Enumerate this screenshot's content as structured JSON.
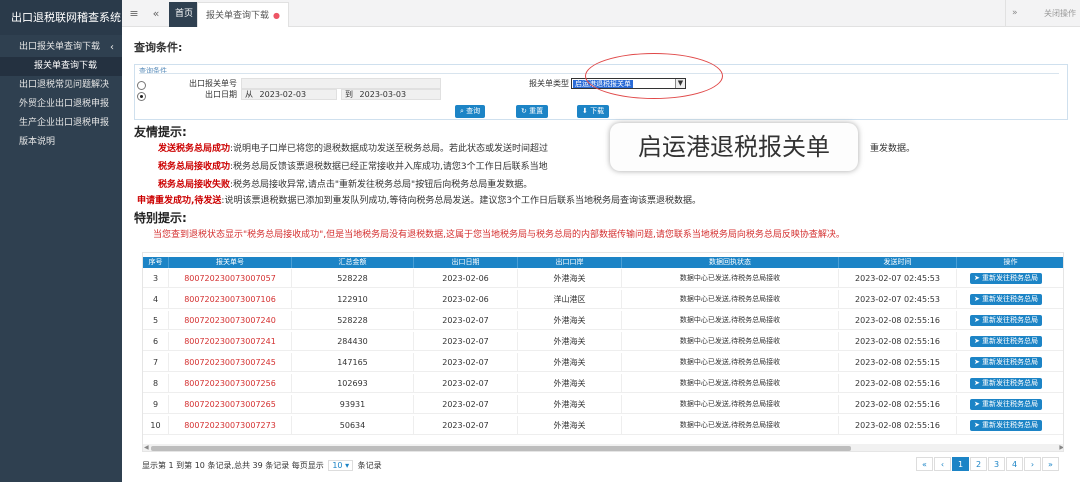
{
  "app": {
    "title": "出口退税联网稽查系统"
  },
  "sidebar": {
    "items": [
      {
        "label": "出口报关单查询下载"
      },
      {
        "label": "报关单查询下载"
      },
      {
        "label": "出口退税常见问题解决"
      },
      {
        "label": "外贸企业出口退税申报"
      },
      {
        "label": "生产企业出口退税申报"
      },
      {
        "label": "版本说明"
      }
    ]
  },
  "topbar": {
    "tab_home": "首页",
    "tab_active": "报关单查询下载",
    "close_ops": "关闭操作"
  },
  "query": {
    "heading": "查询条件:",
    "panel_title": "查询条件",
    "label_no": "出口报关单号",
    "label_date": "出口日期",
    "from_label": "从",
    "date_from": "2023-02-03",
    "to_label": "到",
    "date_to": "2023-03-03",
    "label_type": "报关单类型",
    "type_selected": "启运港退税报关单",
    "btn_query": "查询",
    "btn_reset": "重置",
    "btn_download": "下载"
  },
  "callout": {
    "text": "启运港退税报关单"
  },
  "tips": {
    "heading": "友情提示:",
    "line1_key": "发送税务总局成功",
    "line1_text": ":说明电子口岸已将您的退税数据成功发送至税务总局。若此状态或发送时间超过",
    "line1_tail": "重发数据。",
    "line2_key": "税务总局接收成功",
    "line2_text": ":税务总局反馈该票退税数据已经正常接收并入库成功,请您3个工作日后联系当地",
    "line3_key": "税务总局接收失败",
    "line3_text": ":税务总局接收异常,请点击\"重新发往税务总局\"按钮后向税务总局重发数据。",
    "line4_key": "申请重发成功,待发送",
    "line4_text": ":说明该票退税数据已添加到重发队列成功,等待向税务总局发送。建议您3个工作日后联系当地税务局查询该票退税数据。"
  },
  "special": {
    "heading": "特别提示:",
    "text": "当您查到退税状态显示\"税务总局接收成功\",但是当地税务局没有退税数据,这属于您当地税务局与税务总局的内部数据传输问题,请您联系当地税务局向税务总局反映协查解决。"
  },
  "table": {
    "headers": [
      "序号",
      "报关单号",
      "汇总金额",
      "出口日期",
      "出口口岸",
      "数据回执状态",
      "发送时间",
      "操作"
    ],
    "action_label": "重新发往税务总局",
    "rows": [
      [
        "3",
        "800720230073007057",
        "528228",
        "2023-02-06",
        "外港海关",
        "数据中心已发送,待税务总局接收",
        "2023-02-07 02:45:53"
      ],
      [
        "4",
        "800720230073007106",
        "122910",
        "2023-02-06",
        "洋山港区",
        "数据中心已发送,待税务总局接收",
        "2023-02-07 02:45:53"
      ],
      [
        "5",
        "800720230073007240",
        "528228",
        "2023-02-07",
        "外港海关",
        "数据中心已发送,待税务总局接收",
        "2023-02-08 02:55:16"
      ],
      [
        "6",
        "800720230073007241",
        "284430",
        "2023-02-07",
        "外港海关",
        "数据中心已发送,待税务总局接收",
        "2023-02-08 02:55:16"
      ],
      [
        "7",
        "800720230073007245",
        "147165",
        "2023-02-07",
        "外港海关",
        "数据中心已发送,待税务总局接收",
        "2023-02-08 02:55:15"
      ],
      [
        "8",
        "800720230073007256",
        "102693",
        "2023-02-07",
        "外港海关",
        "数据中心已发送,待税务总局接收",
        "2023-02-08 02:55:16"
      ],
      [
        "9",
        "800720230073007265",
        "93931",
        "2023-02-07",
        "外港海关",
        "数据中心已发送,待税务总局接收",
        "2023-02-08 02:55:16"
      ],
      [
        "10",
        "800720230073007273",
        "50634",
        "2023-02-07",
        "外港海关",
        "数据中心已发送,待税务总局接收",
        "2023-02-08 02:55:16"
      ]
    ]
  },
  "footer": {
    "info_prefix": "显示第 1 到第 10 条记录,总共 39 条记录 每页显示",
    "page_size": "10",
    "info_suffix": "条记录"
  },
  "pagination": {
    "first": "«",
    "prev": "‹",
    "pages": [
      "1",
      "2",
      "3",
      "4"
    ],
    "next": "›",
    "last": "»"
  }
}
